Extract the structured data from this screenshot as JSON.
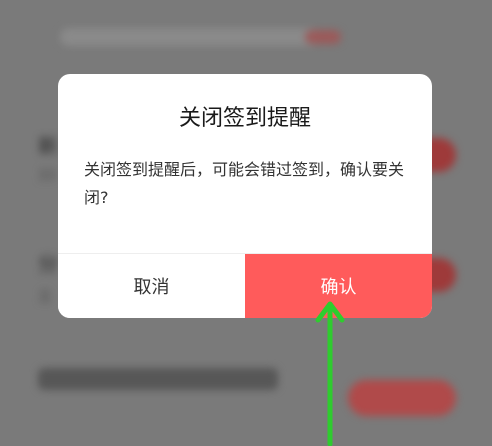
{
  "background": {
    "row1": {
      "title": "新",
      "subtitle": "33"
    },
    "row2": {
      "title": "分",
      "subtitle": "立"
    }
  },
  "dialog": {
    "title": "关闭签到提醒",
    "message": "关闭签到提醒后，可能会错过签到，确认要关闭?",
    "cancel_label": "取消",
    "confirm_label": "确认"
  },
  "colors": {
    "confirm_button": "#ff5b5b",
    "annotation_arrow": "#2ecc2e"
  },
  "icons": {
    "annotation": "arrow-up-icon"
  }
}
